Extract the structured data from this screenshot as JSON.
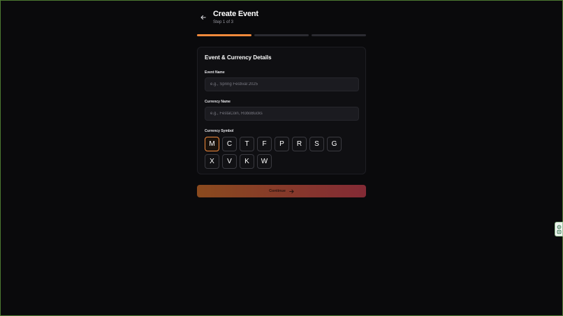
{
  "header": {
    "title": "Create Event",
    "subtitle": "Step 1 of 3"
  },
  "steps": {
    "current": 1,
    "total": 3
  },
  "card": {
    "title": "Event & Currency Details",
    "event_name": {
      "label": "Event Name",
      "value": "",
      "placeholder": "e.g., Spring Festival 2025"
    },
    "currency_name": {
      "label": "Currency Name",
      "value": "",
      "placeholder": "e.g., FestaCoin, RoboBucks"
    },
    "currency_symbol": {
      "label": "Currency Symbol",
      "selected": "M",
      "options": [
        "M",
        "C",
        "T",
        "F",
        "P",
        "R",
        "S",
        "G",
        "X",
        "V",
        "K",
        "W"
      ]
    }
  },
  "continue_button": {
    "label": "Continue"
  },
  "icons": {
    "back": "arrow-left-icon",
    "continue": "arrow-right-icon",
    "side_widget": "assistant-widget-icon"
  },
  "colors": {
    "background": "#0a0a0c",
    "accent": "#f28a3c",
    "card": "#0f0f12",
    "input": "#1b1b20",
    "continue_gradient_start": "#8a4a1e",
    "continue_gradient_end": "#832a35"
  }
}
